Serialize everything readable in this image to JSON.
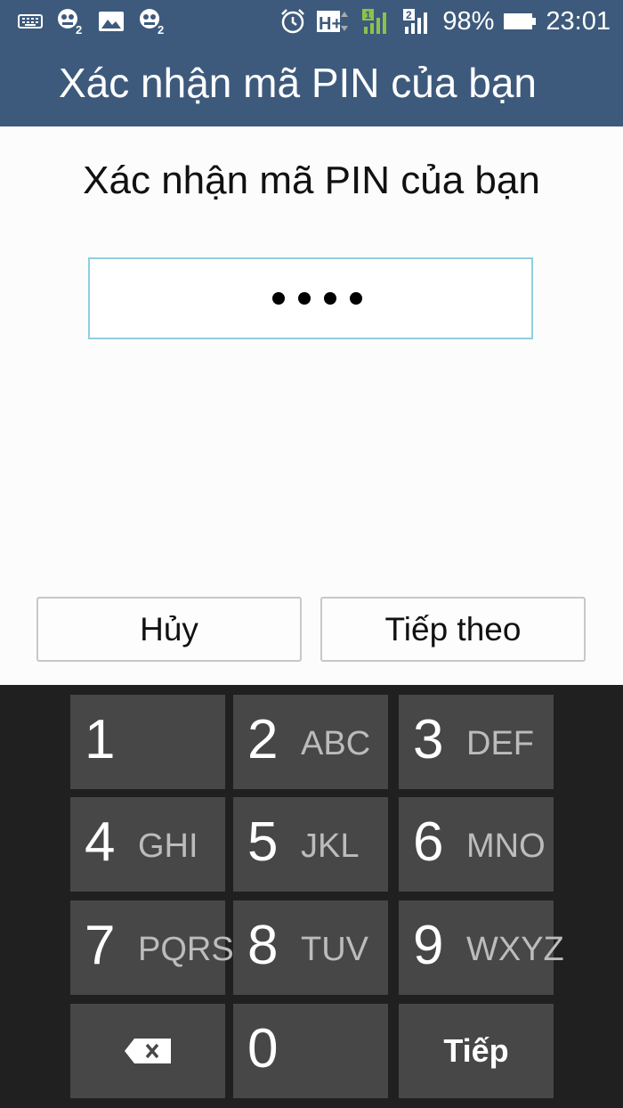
{
  "status_bar": {
    "battery_percent": "98%",
    "time": "23:01",
    "network_type": "H+",
    "sim1_label": "1",
    "sim2_label": "2",
    "battery_level": 0.98
  },
  "action_bar": {
    "title": "Xác nhận mã PIN của bạn"
  },
  "content": {
    "prompt": "Xác nhận mã PIN của bạn",
    "pin_mask": "••••",
    "pin_length": 4
  },
  "buttons": {
    "cancel": "Hủy",
    "next": "Tiếp theo"
  },
  "keypad": {
    "keys": [
      {
        "num": "1",
        "letters": ""
      },
      {
        "num": "2",
        "letters": "ABC"
      },
      {
        "num": "3",
        "letters": "DEF"
      },
      {
        "num": "4",
        "letters": "GHI"
      },
      {
        "num": "5",
        "letters": "JKL"
      },
      {
        "num": "6",
        "letters": "MNO"
      },
      {
        "num": "7",
        "letters": "PQRS"
      },
      {
        "num": "8",
        "letters": "TUV"
      },
      {
        "num": "9",
        "letters": "WXYZ"
      },
      {
        "num": "0",
        "letters": ""
      }
    ],
    "enter_label": "Tiếp",
    "backspace_icon": "backspace-icon"
  },
  "colors": {
    "header": "#3d5a7c",
    "keypad_bg": "#202020",
    "key_bg": "#474747",
    "pin_border": "#8ecfe0"
  }
}
